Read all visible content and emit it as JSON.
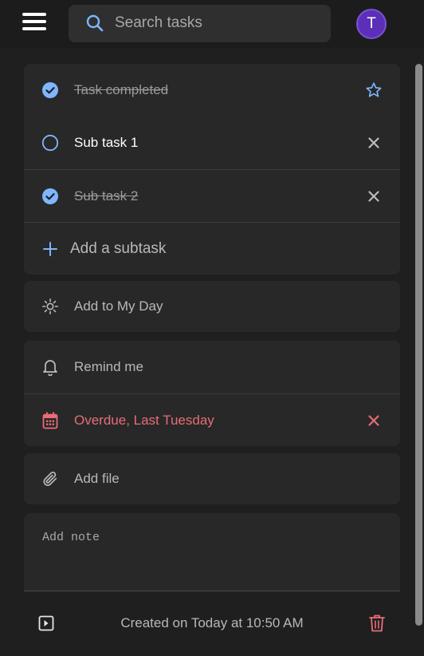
{
  "header": {
    "search_placeholder": "Search tasks",
    "avatar_initial": "T",
    "avatar_color": "#5b2fb8"
  },
  "task": {
    "title": "Task completed",
    "completed": true,
    "important": false,
    "subtasks": [
      {
        "label": "Sub task 1",
        "completed": false
      },
      {
        "label": "Sub task 2",
        "completed": true
      }
    ],
    "add_subtask_label": "Add a subtask"
  },
  "actions": {
    "my_day_label": "Add to My Day",
    "remind_label": "Remind me",
    "due_label": "Overdue, Last Tuesday",
    "file_label": "Add file"
  },
  "note": {
    "placeholder": "Add note"
  },
  "footer": {
    "created_text": "Created on Today at 10:50 AM"
  },
  "colors": {
    "accent": "#7fb6ff",
    "danger": "#e86c77",
    "background": "#1f1f1f",
    "card": "#282828"
  }
}
